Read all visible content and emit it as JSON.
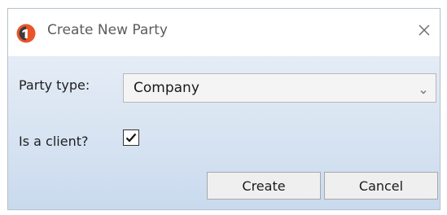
{
  "dialog": {
    "title": "Create New Party",
    "app_icon": "app-logo-icon",
    "close_icon": "close-icon"
  },
  "form": {
    "party_type_label": "Party type:",
    "party_type_value": "Company",
    "is_client_label": "Is a client?",
    "is_client_checked": true
  },
  "buttons": {
    "create_label": "Create",
    "cancel_label": "Cancel"
  },
  "colors": {
    "logo_orange": "#e8552b",
    "logo_dark": "#3b3b3b"
  }
}
